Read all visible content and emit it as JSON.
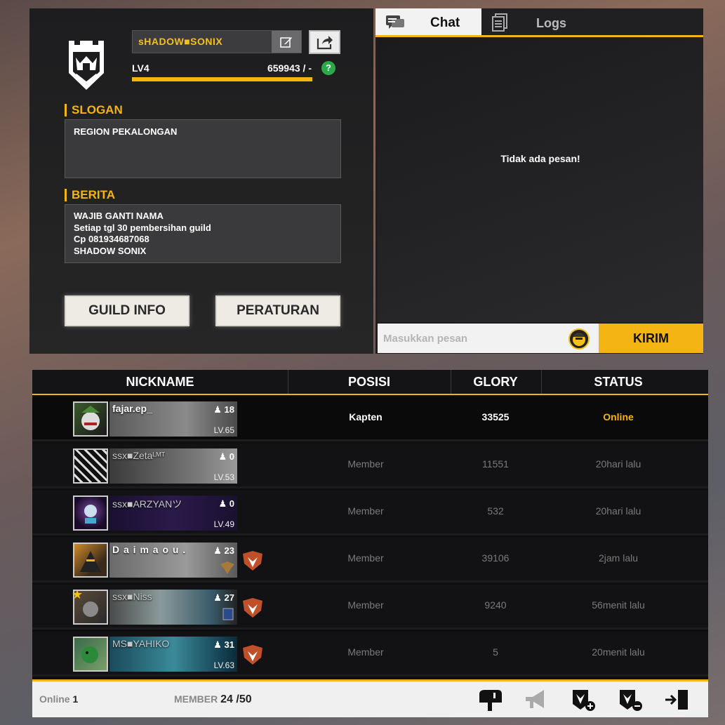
{
  "guild": {
    "name": "sHADOW■SONIX",
    "level": "LV4",
    "exp": "659943 / -",
    "help": "?",
    "slogan_title": "SLOGAN",
    "slogan": "REGION PEKALONGAN",
    "berita_title": "BERITA",
    "berita_lines": [
      "WAJIB GANTI NAMA",
      "Setiap tgl 30 pembersihan guild",
      "Cp 081934687068",
      "SHADOW SONIX"
    ],
    "guild_info_label": "GUILD INFO",
    "peraturan_label": "PERATURAN"
  },
  "chat": {
    "tabs": [
      "Chat",
      "Logs"
    ],
    "empty_message": "Tidak ada pesan!",
    "input_placeholder": "Masukkan pesan",
    "send_label": "KIRIM"
  },
  "table": {
    "headers": [
      "NICKNAME",
      "POSISI",
      "GLORY",
      "STATUS"
    ],
    "rows": [
      {
        "nick": "fajar.ep_",
        "likes": "18",
        "level": "LV.65",
        "position": "Kapten",
        "glory": "33525",
        "status": "Online"
      },
      {
        "nick": "ssx■Zetaᴸᴹᵀ",
        "likes": "0",
        "level": "LV.53",
        "position": "Member",
        "glory": "11551",
        "status": "20hari lalu"
      },
      {
        "nick": "ssx■ARZYANツ",
        "likes": "0",
        "level": "LV.49",
        "position": "Member",
        "glory": "532",
        "status": "20hari lalu"
      },
      {
        "nick": "D a i m a o u .",
        "likes": "23",
        "level": "",
        "position": "Member",
        "glory": "39106",
        "status": "2jam lalu"
      },
      {
        "nick": "ssx■Niss",
        "likes": "27",
        "level": "",
        "position": "Member",
        "glory": "9240",
        "status": "56menit lalu"
      },
      {
        "nick": "MS■YAHIKO",
        "likes": "31",
        "level": "LV.63",
        "position": "Member",
        "glory": "5",
        "status": "20menit lalu"
      }
    ]
  },
  "footer": {
    "online_label": "Online",
    "online_count": "1",
    "member_label": "MEMBER",
    "member_count": "24 /50",
    "icons": [
      "mailbox-icon",
      "megaphone-icon",
      "invite-member-icon",
      "remove-member-icon",
      "exit-guild-icon"
    ]
  },
  "colors": {
    "accent": "#f4b414",
    "panel": "#1e1e20",
    "row": "#121214"
  }
}
